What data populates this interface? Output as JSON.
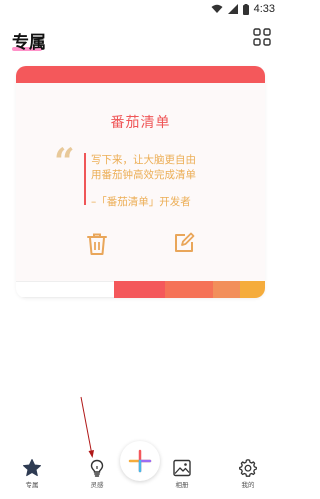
{
  "status_bar": {
    "time": "4:33",
    "icons": [
      "wifi-icon",
      "signal-icon",
      "battery-icon"
    ]
  },
  "header": {
    "title": "专属",
    "accent_color": "#ff7fc0",
    "grid_icon": "grid-icon"
  },
  "card": {
    "title": "番茄清单",
    "quote_lines": [
      "写下来，让大脑更自由",
      "用番茄钟高效完成清单"
    ],
    "quote_source": "–「番茄清单」开发者",
    "actions": [
      "trash-icon",
      "edit-icon"
    ],
    "top_color": "#f4585b",
    "title_color": "#ef5658",
    "quote_color": "#ecae56",
    "palette": [
      "#ffffff",
      "#f4585b",
      "#f57257",
      "#f28f5b",
      "#f5ac3c"
    ]
  },
  "bottom_nav": {
    "items": [
      {
        "icon": "star-icon",
        "label": "专属"
      },
      {
        "icon": "lightbulb-icon",
        "label": "灵感"
      },
      {
        "icon": "image-icon",
        "label": "相册"
      },
      {
        "icon": "gear-icon",
        "label": "我的"
      }
    ],
    "fab_icon": "plus-icon"
  }
}
